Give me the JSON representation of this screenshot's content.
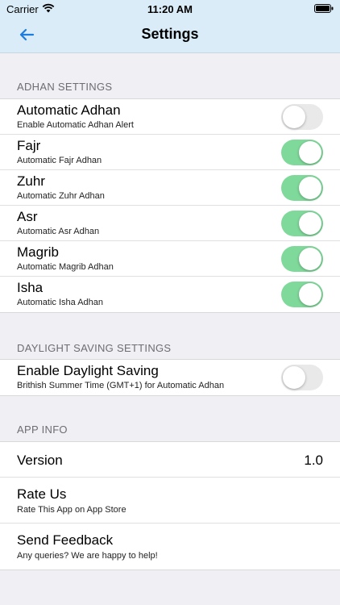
{
  "status_bar": {
    "carrier": "Carrier",
    "time": "11:20 AM"
  },
  "nav": {
    "title": "Settings",
    "back_icon": "arrow-left-icon",
    "accent": "#1e7be0"
  },
  "adhan_settings": {
    "header": "ADHAN SETTINGS",
    "items": [
      {
        "title": "Automatic Adhan",
        "subtitle": "Enable Automatic Adhan Alert",
        "enabled": false
      },
      {
        "title": "Fajr",
        "subtitle": "Automatic Fajr Adhan",
        "enabled": true
      },
      {
        "title": "Zuhr",
        "subtitle": "Automatic Zuhr Adhan",
        "enabled": true
      },
      {
        "title": "Asr",
        "subtitle": "Automatic Asr Adhan",
        "enabled": true
      },
      {
        "title": "Magrib",
        "subtitle": "Automatic Magrib Adhan",
        "enabled": true
      },
      {
        "title": "Isha",
        "subtitle": "Automatic Isha Adhan",
        "enabled": true
      }
    ]
  },
  "daylight_settings": {
    "header": "DAYLIGHT SAVING SETTINGS",
    "item": {
      "title": "Enable Daylight Saving",
      "subtitle": "Brithish Summer Time (GMT+1) for Automatic Adhan",
      "enabled": false
    }
  },
  "app_info": {
    "header": "APP INFO",
    "version_label": "Version",
    "version_value": "1.0",
    "rate_title": "Rate Us",
    "rate_subtitle": "Rate This App on App Store",
    "feedback_title": "Send Feedback",
    "feedback_subtitle": "Any queries? We are happy to help!"
  },
  "colors": {
    "toggle_on": "#7fd99a",
    "toggle_off": "#e9e9ea",
    "header_bg": "#d9ecf8"
  }
}
